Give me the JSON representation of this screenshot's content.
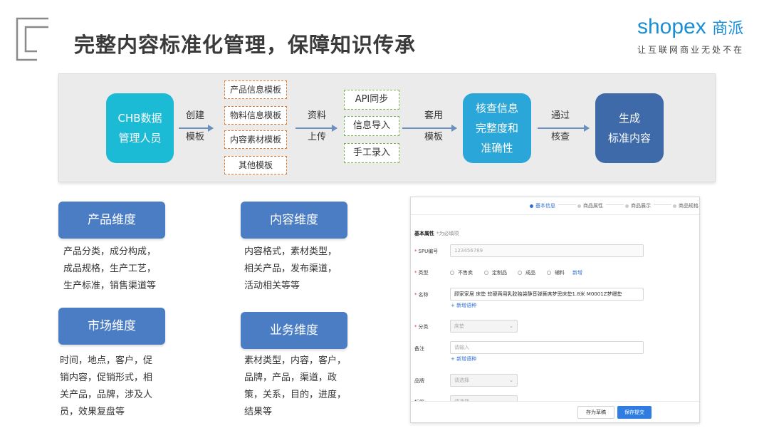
{
  "page": {
    "title": "完整内容标准化管理，保障知识传承"
  },
  "brand": {
    "name_en": "shopex",
    "name_cn": "商派",
    "slogan": "让互联网商业无处不在",
    "color": "#1a8fd6"
  },
  "flow": {
    "node_admin": [
      "CHB数据",
      "管理人员"
    ],
    "step_create": [
      "创建",
      "模板"
    ],
    "templates": [
      "产品信息模板",
      "物料信息模板",
      "内容素材模板",
      "其他模板"
    ],
    "step_upload": [
      "资料",
      "上传"
    ],
    "sources": [
      "API同步",
      "信息导入",
      "手工录入"
    ],
    "step_apply": [
      "套用",
      "模板"
    ],
    "node_check": [
      "核查信息",
      "完整度和",
      "准确性"
    ],
    "step_pass": [
      "通过",
      "核查"
    ],
    "node_generate": [
      "生成",
      "标准内容"
    ]
  },
  "dimensions": [
    {
      "title": "产品维度",
      "lines": [
        "产品分类，成分构成，",
        "成品规格，生产工艺，",
        "生产标准，销售渠道等"
      ]
    },
    {
      "title": "内容维度",
      "lines": [
        "内容格式，素材类型，",
        "相关产品，发布渠道，",
        "活动相关等等"
      ]
    },
    {
      "title": "市场维度",
      "lines": [
        "时间，地点，客户，促",
        "销内容，促销形式，相",
        "关产品，品牌，涉及人",
        "员，效果复盘等"
      ]
    },
    {
      "title": "业务维度",
      "lines": [
        "素材类型，内容，客户，",
        "品牌，产品，渠道，政",
        "策，关系，目的，进度，",
        "结果等"
      ]
    }
  ],
  "screenshot": {
    "steps": [
      "基本信息",
      "商品属性",
      "商品展示",
      "商品规格"
    ],
    "section_title": "基本属性",
    "section_hint": "*为必填项",
    "spu_label": "SPU编号",
    "spu_value": "123456789",
    "type_label": "类型",
    "type_options": [
      "不售卖",
      "定制品",
      "成品",
      "辅料"
    ],
    "type_add": "新增",
    "name_label": "名称",
    "name_value": "顾家家居 床垫 软硬两用乳胶独袋静音弹簧席梦思床垫1.8米 M0001Z梦缦垫",
    "name_add": "+ 新增语种",
    "category_label": "分类",
    "category_value": "床垫",
    "remark_label": "备注",
    "remark_placeholder": "请输入",
    "remark_add": "+ 新增语种",
    "brand_label": "品牌",
    "brand_placeholder": "请选择",
    "extra_label": "标签",
    "extra_placeholder": "请选择",
    "draft_button": "存为草稿",
    "submit_button": "保存提交",
    "accent_color": "#2f7de1"
  }
}
